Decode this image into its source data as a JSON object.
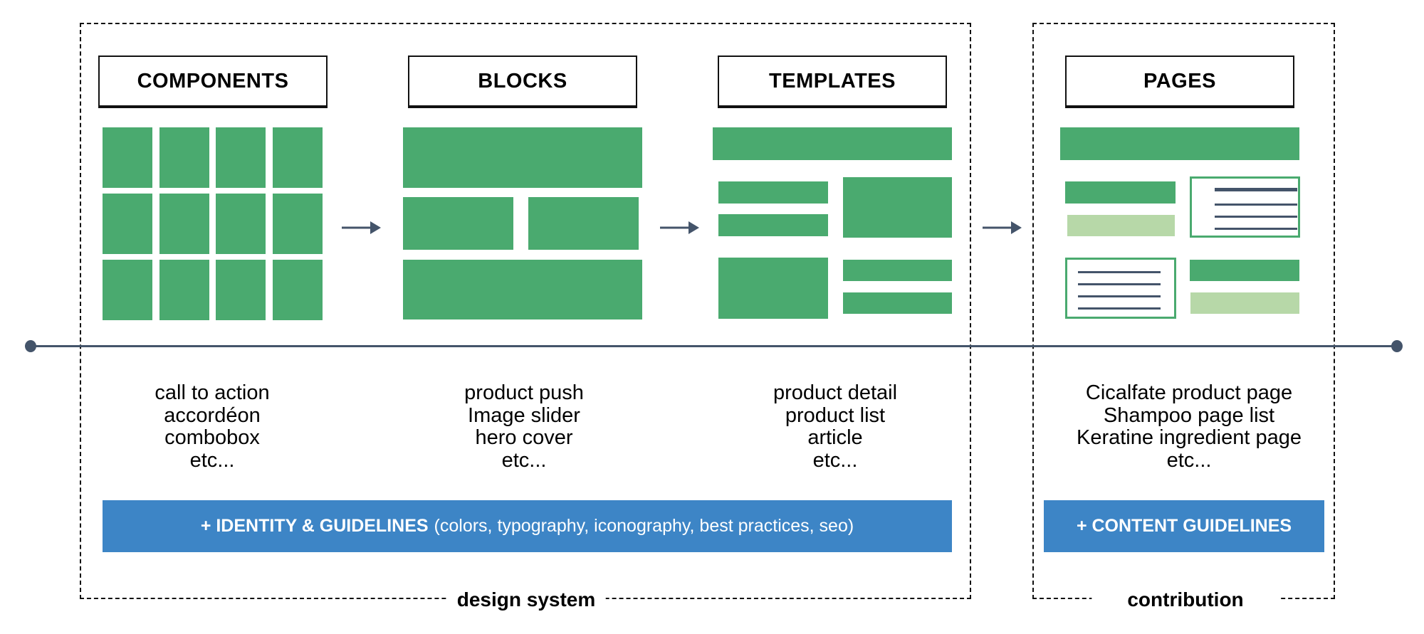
{
  "colors": {
    "green": "#4aaa6f",
    "light_green": "#b7d8a8",
    "blue": "#3d85c6",
    "timeline": "#44546a"
  },
  "stages": [
    {
      "title": "COMPONENTS",
      "examples": [
        "call to action",
        "accordéon",
        "combobox",
        "etc..."
      ]
    },
    {
      "title": "BLOCKS",
      "examples": [
        "product push",
        "Image slider",
        "hero cover",
        "etc..."
      ]
    },
    {
      "title": "TEMPLATES",
      "examples": [
        "product detail",
        "product list",
        "article",
        "etc..."
      ]
    },
    {
      "title": "PAGES",
      "examples": [
        "Cicalfate product page",
        "Shampoo page list",
        "Keratine ingredient page",
        "etc..."
      ]
    }
  ],
  "design_system": {
    "label": "design system",
    "banner_bold": "+ IDENTITY & GUIDELINES",
    "banner_rest": "(colors, typography, iconography, best practices, seo)"
  },
  "contribution": {
    "label": "contribution",
    "banner_bold": "+ CONTENT GUIDELINES"
  }
}
